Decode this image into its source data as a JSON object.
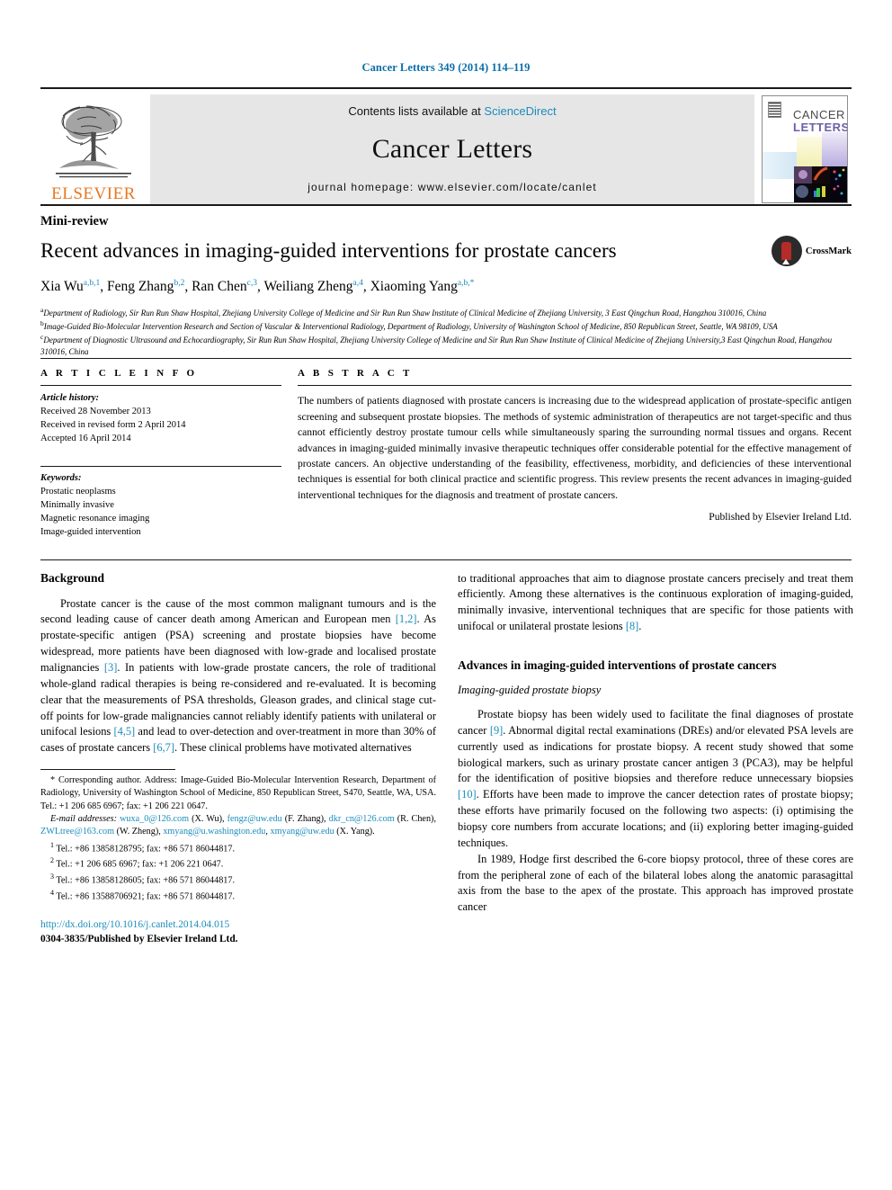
{
  "runhead": "Cancer Letters 349 (2014) 114–119",
  "masthead": {
    "publisher": "ELSEVIER",
    "contents_prefix": "Contents lists available at ",
    "contents_link": "ScienceDirect",
    "journal_title": "Cancer Letters",
    "homepage": "journal homepage: www.elsevier.com/locate/canlet",
    "cover_title_line1": "CANCER",
    "cover_title_line2": "LETTERS"
  },
  "article": {
    "type_label": "Mini-review",
    "title": "Recent advances in imaging-guided interventions for prostate cancers",
    "crossmark_label": "CrossMark",
    "authors": [
      {
        "name": "Xia Wu",
        "marks": "a,b,1",
        "sep": ", "
      },
      {
        "name": "Feng Zhang",
        "marks": "b,2",
        "sep": ", "
      },
      {
        "name": "Ran Chen",
        "marks": "c,3",
        "sep": ", "
      },
      {
        "name": "Weiliang Zheng",
        "marks": "a,4",
        "sep": ", "
      },
      {
        "name": "Xiaoming Yang",
        "marks": "a,b,*",
        "sep": ""
      }
    ],
    "affiliations": [
      {
        "mark": "a",
        "text": "Department of Radiology, Sir Run Run Shaw Hospital, Zhejiang University College of Medicine and Sir Run Run Shaw Institute of Clinical Medicine of Zhejiang University, 3 East Qingchun Road, Hangzhou 310016, China"
      },
      {
        "mark": "b",
        "text": "Image-Guided Bio-Molecular Intervention Research and Section of Vascular & Interventional Radiology, Department of Radiology, University of Washington School of Medicine, 850 Republican Street, Seattle, WA 98109, USA"
      },
      {
        "mark": "c",
        "text": "Department of Diagnostic Ultrasound and Echocardiography, Sir Run Run Shaw Hospital, Zhejiang University College of Medicine and Sir Run Run Shaw Institute of Clinical Medicine of Zhejiang University,3 East Qingchun Road, Hangzhou 310016, China"
      }
    ]
  },
  "info": {
    "heading": "A R T I C L E    I N F O",
    "history_label": "Article history:",
    "history": [
      "Received 28 November 2013",
      "Received in revised form 2 April 2014",
      "Accepted 16 April 2014"
    ],
    "keywords_label": "Keywords:",
    "keywords": [
      "Prostatic neoplasms",
      "Minimally invasive",
      "Magnetic resonance imaging",
      "Image-guided intervention"
    ]
  },
  "abstract": {
    "heading": "A B S T R A C T",
    "text": "The numbers of patients diagnosed with prostate cancers is increasing due to the widespread application of prostate-specific antigen screening and subsequent prostate biopsies. The methods of systemic administration of therapeutics are not target-specific and thus cannot efficiently destroy prostate tumour cells while simultaneously sparing the surrounding normal tissues and organs. Recent advances in imaging-guided minimally invasive therapeutic techniques offer considerable potential for the effective management of prostate cancers. An objective understanding of the feasibility, effectiveness, morbidity, and deficiencies of these interventional techniques is essential for both clinical practice and scientific progress. This review presents the recent advances in imaging-guided interventional techniques for the diagnosis and treatment of prostate cancers.",
    "footer": "Published by Elsevier Ireland Ltd."
  },
  "body": {
    "left": {
      "heading": "Background",
      "para1_a": "Prostate cancer is the cause of the most common malignant tumours and is the second leading cause of cancer death among American and European men ",
      "ref1": "[1,2]",
      "para1_b": ". As prostate-specific antigen (PSA) screening and prostate biopsies have become widespread, more patients have been diagnosed with low-grade and localised prostate malignancies ",
      "ref2": "[3]",
      "para1_c": ". In patients with low-grade prostate cancers, the role of traditional whole-gland radical therapies is being re-considered and re-evaluated. It is becoming clear that the measurements of PSA thresholds, Gleason grades, and clinical stage cut-off points for low-grade malignancies cannot reliably identify patients with unilateral or unifocal lesions ",
      "ref3": "[4,5]",
      "para1_d": " and lead to over-detection and over-treatment in more than 30% of cases of prostate cancers ",
      "ref4": "[6,7]",
      "para1_e": ". These clinical problems have motivated alternatives"
    },
    "right": {
      "para_cont": "to traditional approaches that aim to diagnose prostate cancers precisely and treat them efficiently. Among these alternatives is the continuous exploration of imaging-guided, minimally invasive, interventional techniques that are specific for those patients with unifocal or unilateral prostate lesions ",
      "ref8": "[8]",
      "para_cont_end": ".",
      "heading": "Advances in imaging-guided interventions of prostate cancers",
      "subheading": "Imaging-guided prostate biopsy",
      "para2_a": "Prostate biopsy has been widely used to facilitate the final diagnoses of prostate cancer ",
      "ref9": "[9]",
      "para2_b": ". Abnormal digital rectal examinations (DREs) and/or elevated PSA levels are currently used as indications for prostate biopsy. A recent study showed that some biological markers, such as urinary prostate cancer antigen 3 (PCA3), may be helpful for the identification of positive biopsies and therefore reduce unnecessary biopsies ",
      "ref10": "[10]",
      "para2_c": ". Efforts have been made to improve the cancer detection rates of prostate biopsy; these efforts have primarily focused on the following two aspects: (i) optimising the biopsy core numbers from accurate locations; and (ii) exploring better imaging-guided techniques.",
      "para3": "In 1989, Hodge first described the 6-core biopsy protocol, three of these cores are from the peripheral zone of each of the bilateral lobes along the anatomic parasagittal axis from the base to the apex of the prostate. This approach has improved prostate cancer"
    }
  },
  "footnotes": {
    "corresponding": "* Corresponding author. Address: Image-Guided Bio-Molecular Intervention Research, Department of Radiology, University of Washington School of Medicine, 850 Republican Street, S470, Seattle, WA, USA. Tel.: +1 206 685 6967; fax: +1 206 221 0647.",
    "email_label": "E-mail addresses:",
    "emails": [
      {
        "addr": "wuxa_0@126.com",
        "who": " (X. Wu), "
      },
      {
        "addr": "fengz@uw.edu",
        "who": " (F. Zhang), "
      },
      {
        "addr": "dkr_cn@126.com",
        "who": " (R. Chen), "
      },
      {
        "addr": "ZWLtree@163.com",
        "who": " (W. Zheng), "
      },
      {
        "addr": "xmyang@u.washington.edu",
        "who": ", "
      },
      {
        "addr": "xmyang@uw.edu",
        "who": " (X. Yang)."
      }
    ],
    "numbered": [
      {
        "mark": "1",
        "text": "Tel.: +86 13858128795; fax: +86 571 86044817."
      },
      {
        "mark": "2",
        "text": "Tel.: +1 206 685 6967; fax: +1 206 221 0647."
      },
      {
        "mark": "3",
        "text": "Tel.: +86 13858128605; fax: +86 571 86044817."
      },
      {
        "mark": "4",
        "text": "Tel.: +86 13588706921; fax: +86 571 86044817."
      }
    ],
    "doi": "http://dx.doi.org/10.1016/j.canlet.2014.04.015",
    "issn": "0304-3835/Published by Elsevier Ireland Ltd."
  },
  "colors": {
    "link": "#1a8cbb",
    "elsevier_orange": "#e87722",
    "crossmark_red": "#b52b27"
  }
}
